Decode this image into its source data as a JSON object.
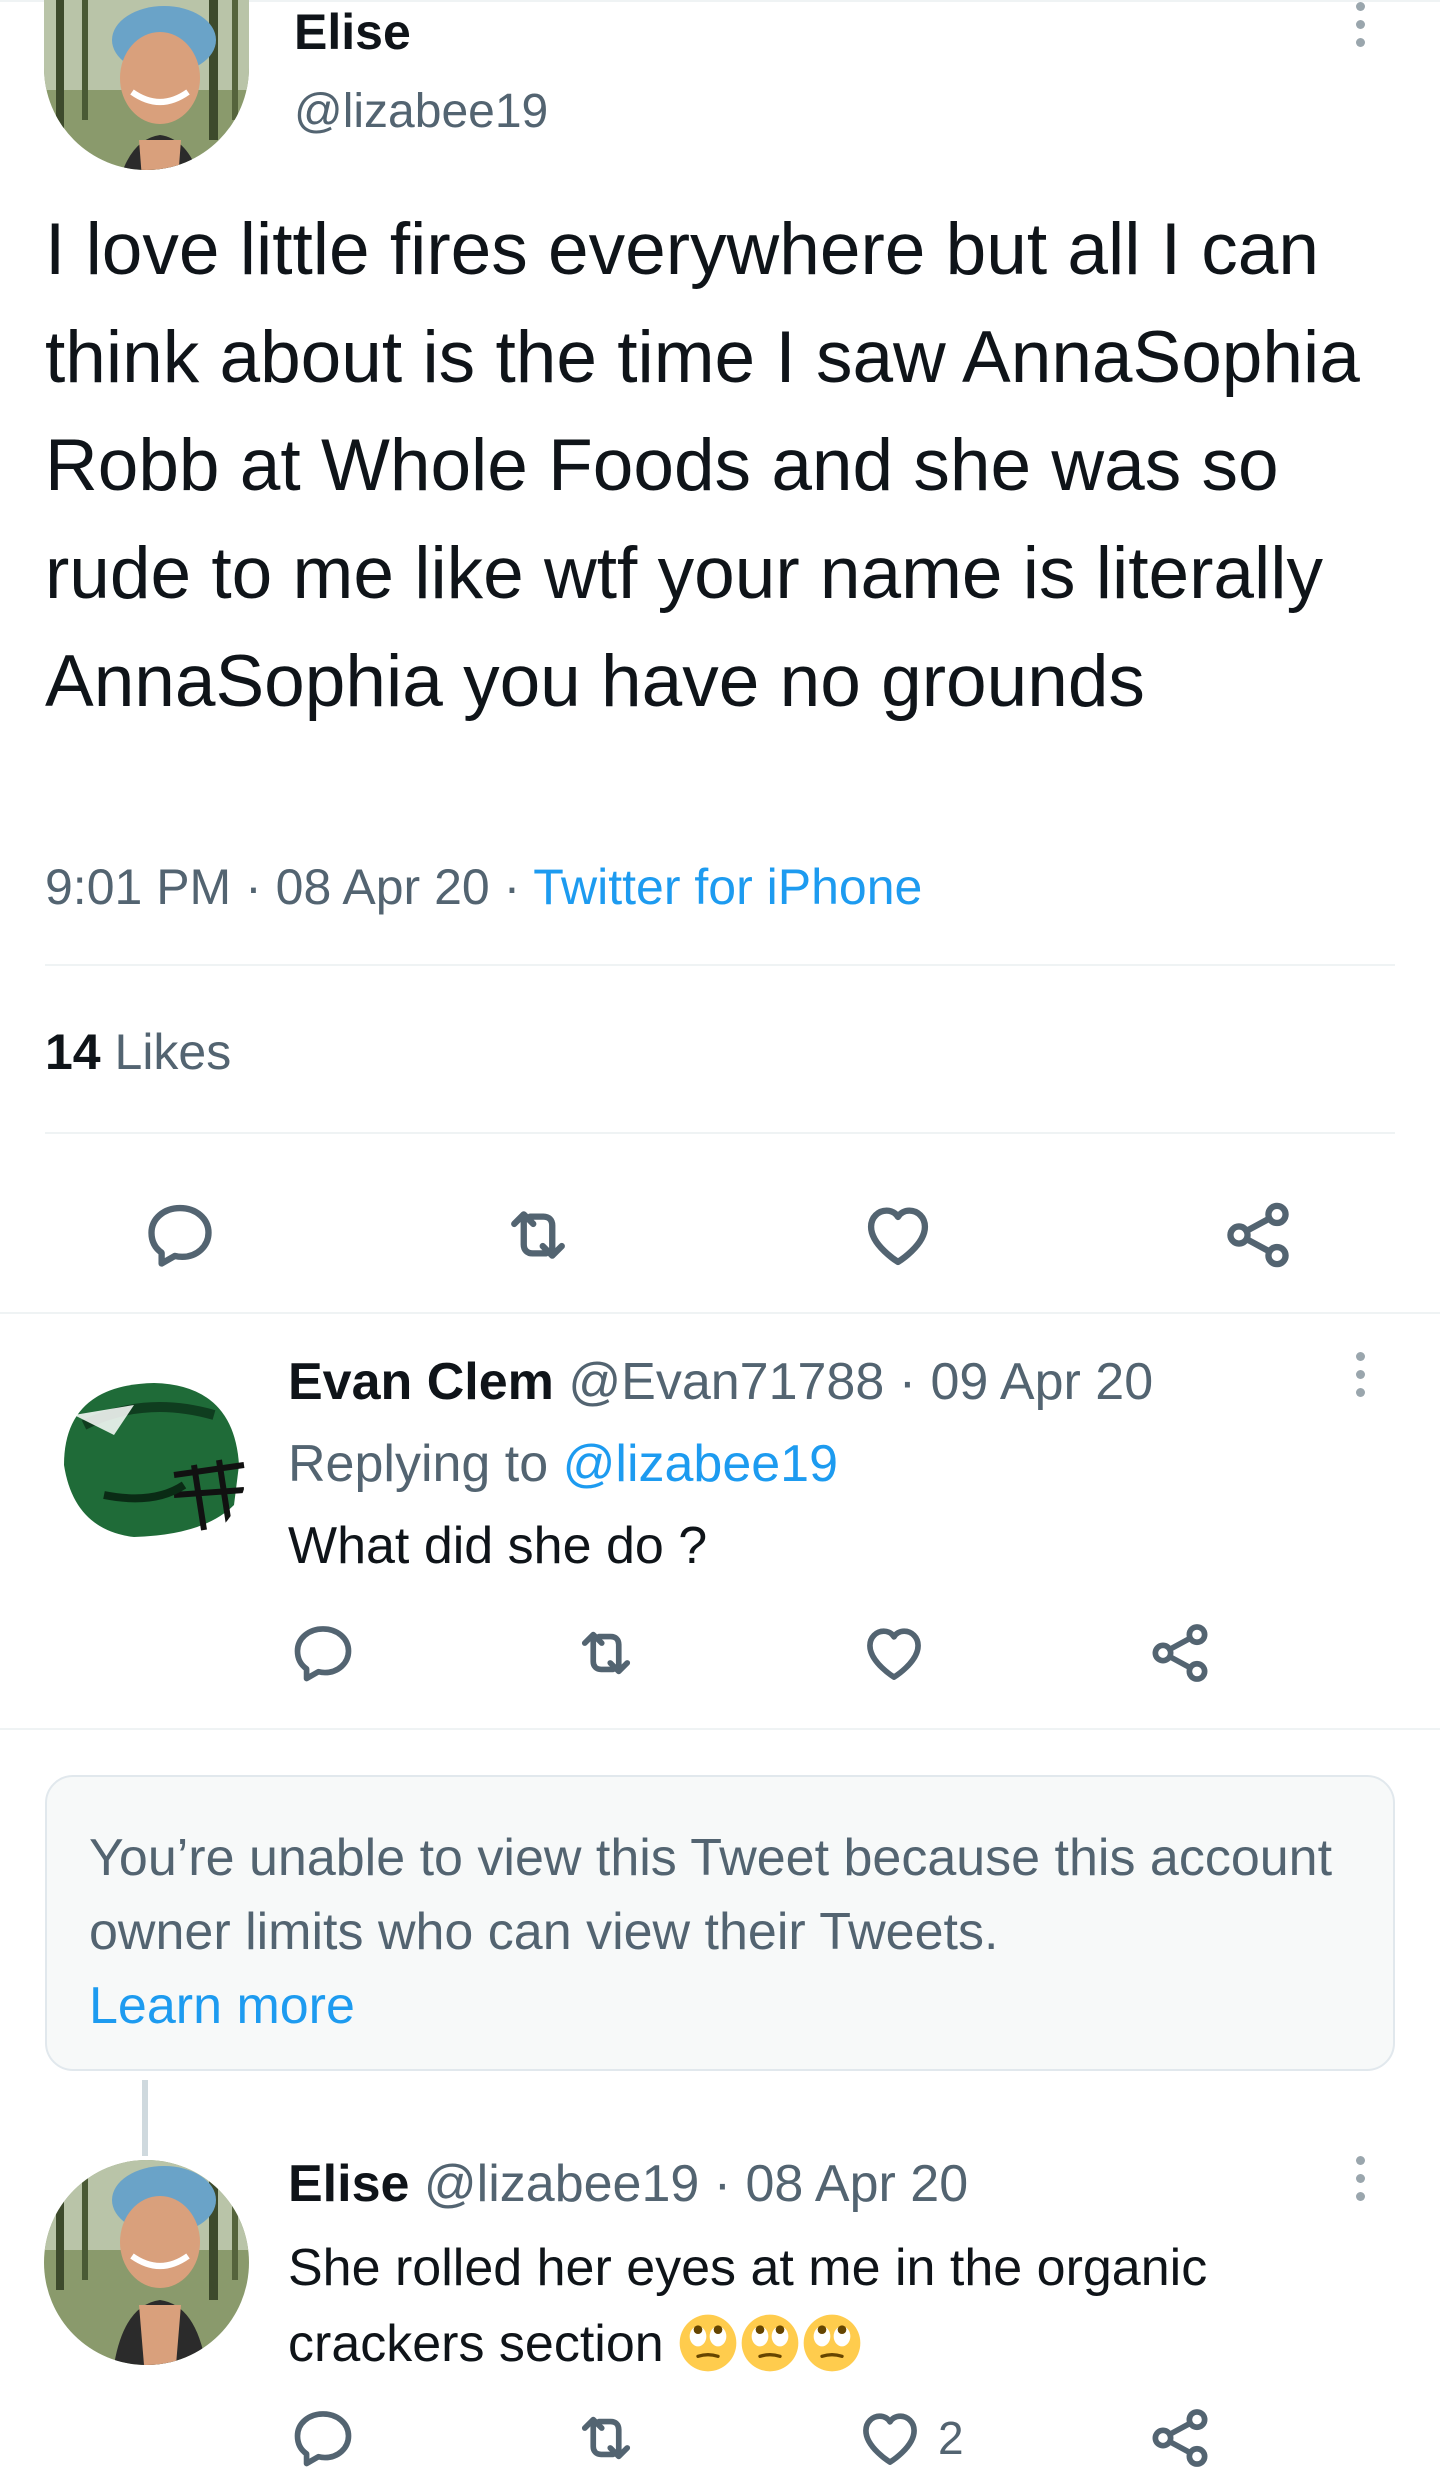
{
  "main_tweet": {
    "author_name": "Elise",
    "author_handle": "@lizabee19",
    "text": "I love little fires everywhere but all I can think about is the time I saw AnnaSophia Robb at Whole Foods and she was so rude to me like wtf your name is literally AnnaSophia you have no grounds",
    "time": "9:01 PM",
    "separator": " · ",
    "date": "08 Apr 20",
    "source": "Twitter for iPhone",
    "likes_count": "14",
    "likes_label": " Likes"
  },
  "reply_1": {
    "author_name": "Evan Clem",
    "author_handle": "@Evan71788",
    "separator": " · ",
    "date": "09 Apr 20",
    "replying_label": "Replying to ",
    "replying_to": "@lizabee19",
    "text": "What did she do ?"
  },
  "unavailable_notice": {
    "message": "You’re unable to view this Tweet because this account owner limits who can view their Tweets.",
    "link": "Learn more"
  },
  "reply_2": {
    "author_name": "Elise",
    "author_handle": "@lizabee19",
    "separator": " · ",
    "date": "08 Apr 20",
    "text": "She rolled her eyes at me in the organic crackers section",
    "emoji_name": "face-with-rolling-eyes",
    "likes": "2"
  },
  "icons": {
    "reply": "reply-icon",
    "retweet": "retweet-icon",
    "like": "heart-icon",
    "share": "share-icon",
    "more": "more-icon"
  },
  "colors": {
    "text_primary": "#0f1419",
    "text_secondary": "#536471",
    "accent": "#1d9bf0",
    "divider": "#eff3f4"
  }
}
